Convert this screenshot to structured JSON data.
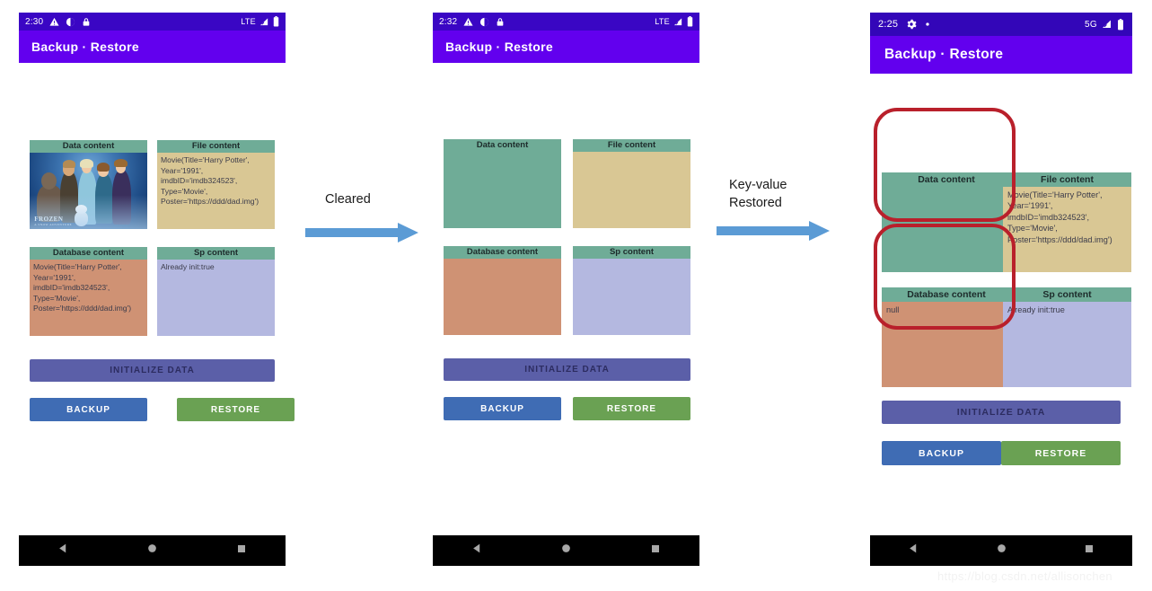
{
  "page": {
    "background": "#ffffff",
    "watermark": "https://blog.csdn.net/allisonchen",
    "accent_purple": "#6200ee",
    "statusbar_purple": "#3a06c4",
    "annotation_red": "#b9202b",
    "arrow_blue": "#5b9bd5"
  },
  "labels": {
    "header_green": "#6fac97",
    "data_content": "Data content",
    "file_content": "File content",
    "database_content": "Database content",
    "sp_content": "Sp content"
  },
  "texts": {
    "movie_record": "Movie(Title='Harry Potter', Year='1991', imdbID='imdb324523', Type='Movie', Poster='https://ddd/dad.img')",
    "sp_value": "Already init:true",
    "null_value": "null",
    "empty": ""
  },
  "buttons": {
    "initialize": "INITIALIZE DATA",
    "backup": "BACKUP",
    "restore": "RESTORE"
  },
  "poster": {
    "title": "FROZEN",
    "subtitle": "A SNOW ADVENTURE"
  },
  "phones": [
    {
      "id": "phone-before",
      "statusbar": {
        "time": "2:30",
        "icons_left": [
          "warning-triangle-icon",
          "do-not-disturb-icon",
          "lock-icon"
        ],
        "network": "LTE",
        "icons_right": [
          "signal-icon",
          "battery-icon"
        ]
      },
      "appbar_title": "Backup · Restore",
      "cards": {
        "data": {
          "header": "Data content",
          "body": "",
          "kind": "poster"
        },
        "file": {
          "header": "File content",
          "body": "Movie(Title='Harry Potter', Year='1991', imdbID='imdb324523', Type='Movie', Poster='https://ddd/dad.img')"
        },
        "database": {
          "header": "Database content",
          "body": "Movie(Title='Harry Potter', Year='1991', imdbID='imdb324523', Type='Movie', Poster='https://ddd/dad.img')"
        },
        "sp": {
          "header": "Sp content",
          "body": "Already init:true"
        }
      },
      "annotations": []
    },
    {
      "id": "phone-cleared",
      "statusbar": {
        "time": "2:32",
        "icons_left": [
          "warning-triangle-icon",
          "do-not-disturb-icon",
          "lock-icon"
        ],
        "network": "LTE",
        "icons_right": [
          "signal-icon",
          "battery-icon"
        ]
      },
      "appbar_title": "Backup · Restore",
      "cards": {
        "data": {
          "header": "Data content",
          "body": "",
          "kind": "empty"
        },
        "file": {
          "header": "File content",
          "body": ""
        },
        "database": {
          "header": "Database content",
          "body": ""
        },
        "sp": {
          "header": "Sp content",
          "body": ""
        }
      },
      "annotations": []
    },
    {
      "id": "phone-restored",
      "statusbar": {
        "time": "2:25",
        "icons_left": [
          "gear-icon",
          "dot-icon"
        ],
        "network": "5G",
        "icons_right": [
          "signal-icon",
          "battery-icon"
        ]
      },
      "appbar_title": "Backup · Restore",
      "cards": {
        "data": {
          "header": "Data content",
          "body": "",
          "kind": "empty"
        },
        "file": {
          "header": "File content",
          "body": "Movie(Title='Harry Potter', Year='1991', imdbID='imdb324523', Type='Movie', Poster='https://ddd/dad.img')"
        },
        "database": {
          "header": "Database content",
          "body": "null"
        },
        "sp": {
          "header": "Sp content",
          "body": "Already init:true"
        }
      },
      "annotations": [
        "data-content-highlight",
        "database-content-highlight"
      ]
    }
  ],
  "arrows": [
    {
      "id": "arrow-cleared",
      "label": "Cleared"
    },
    {
      "id": "arrow-restored",
      "label": "Key-value\nRestored"
    }
  ],
  "navbar": {
    "back": "back-triangle-icon",
    "home": "home-circle-icon",
    "recents": "recents-square-icon"
  }
}
